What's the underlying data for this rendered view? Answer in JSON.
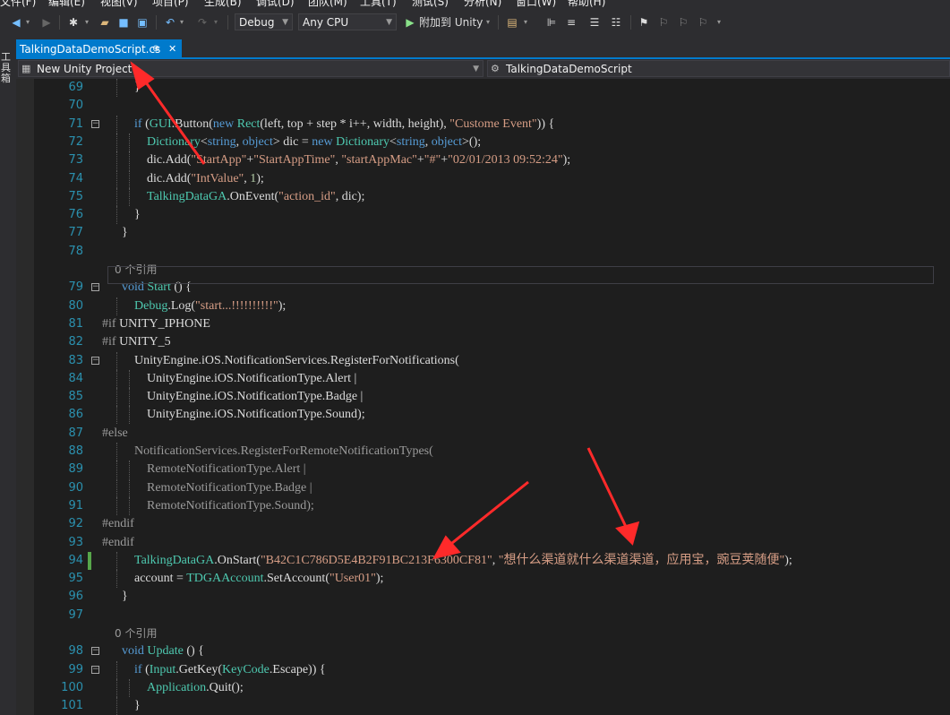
{
  "menu": [
    "文件(F)",
    "编辑(E)",
    "视图(V)",
    "项目(P)",
    "生成(B)",
    "调试(D)",
    "团队(M)",
    "工具(T)",
    "测试(S)",
    "分析(N)",
    "窗口(W)",
    "帮助(H)"
  ],
  "toolbar": {
    "config": "Debug",
    "platform": "Any CPU",
    "attach": "附加到 Unity",
    "play_glyph": "▶"
  },
  "left_strip": "工具箱",
  "tab": {
    "title": "TalkingDataDemoScript.cs",
    "pin": "⊕",
    "close": "✕"
  },
  "navbar": {
    "project": "New Unity Project",
    "class": "TalkingDataDemoScript"
  },
  "code_lines": [
    {
      "n": "69",
      "fold": "",
      "indent": 2,
      "segs": [
        {
          "t": "}",
          "c": ""
        }
      ]
    },
    {
      "n": "70",
      "fold": "",
      "indent": 0,
      "segs": []
    },
    {
      "n": "71",
      "fold": "−",
      "indent": 2,
      "segs": [
        {
          "t": "if",
          "c": "kw"
        },
        {
          "t": " (",
          "c": ""
        },
        {
          "t": "GUI",
          "c": "ty"
        },
        {
          "t": ".Button(",
          "c": ""
        },
        {
          "t": "new",
          "c": "kw"
        },
        {
          "t": " ",
          "c": ""
        },
        {
          "t": "Rect",
          "c": "ty"
        },
        {
          "t": "(left, top + step * i++, width, height), ",
          "c": ""
        },
        {
          "t": "\"Custome Event\"",
          "c": "st"
        },
        {
          "t": ")) {",
          "c": ""
        }
      ]
    },
    {
      "n": "72",
      "fold": "",
      "indent": 3,
      "segs": [
        {
          "t": "Dictionary",
          "c": "ty"
        },
        {
          "t": "<",
          "c": ""
        },
        {
          "t": "string",
          "c": "kw"
        },
        {
          "t": ", ",
          "c": ""
        },
        {
          "t": "object",
          "c": "kw"
        },
        {
          "t": "> dic = ",
          "c": ""
        },
        {
          "t": "new",
          "c": "kw"
        },
        {
          "t": " ",
          "c": ""
        },
        {
          "t": "Dictionary",
          "c": "ty"
        },
        {
          "t": "<",
          "c": ""
        },
        {
          "t": "string",
          "c": "kw"
        },
        {
          "t": ", ",
          "c": ""
        },
        {
          "t": "object",
          "c": "kw"
        },
        {
          "t": ">();",
          "c": ""
        }
      ]
    },
    {
      "n": "73",
      "fold": "",
      "indent": 3,
      "segs": [
        {
          "t": "dic.Add(",
          "c": ""
        },
        {
          "t": "\"StartApp\"",
          "c": "st"
        },
        {
          "t": "+",
          "c": ""
        },
        {
          "t": "\"StartAppTime\"",
          "c": "st"
        },
        {
          "t": ", ",
          "c": ""
        },
        {
          "t": "\"startAppMac\"",
          "c": "st"
        },
        {
          "t": "+",
          "c": ""
        },
        {
          "t": "\"#\"",
          "c": "st"
        },
        {
          "t": "+",
          "c": ""
        },
        {
          "t": "\"02/01/2013 09:52:24\"",
          "c": "st"
        },
        {
          "t": ");",
          "c": ""
        }
      ]
    },
    {
      "n": "74",
      "fold": "",
      "indent": 3,
      "segs": [
        {
          "t": "dic.Add(",
          "c": ""
        },
        {
          "t": "\"IntValue\"",
          "c": "st"
        },
        {
          "t": ", ",
          "c": ""
        },
        {
          "t": "1",
          "c": "nm"
        },
        {
          "t": ");",
          "c": ""
        }
      ]
    },
    {
      "n": "75",
      "fold": "",
      "indent": 3,
      "segs": [
        {
          "t": "TalkingDataGA",
          "c": "ty"
        },
        {
          "t": ".OnEvent(",
          "c": ""
        },
        {
          "t": "\"action_id\"",
          "c": "st"
        },
        {
          "t": ", dic);",
          "c": ""
        }
      ]
    },
    {
      "n": "76",
      "fold": "",
      "indent": 2,
      "segs": [
        {
          "t": "}",
          "c": ""
        }
      ]
    },
    {
      "n": "77",
      "fold": "",
      "indent": 1,
      "segs": [
        {
          "t": "}",
          "c": ""
        }
      ]
    },
    {
      "n": "78",
      "fold": "",
      "indent": 0,
      "segs": []
    },
    {
      "n": "",
      "fold": "",
      "indent": 1,
      "lens": "0 个引用",
      "segs": []
    },
    {
      "n": "79",
      "fold": "−",
      "indent": 1,
      "segs": [
        {
          "t": "void",
          "c": "kw"
        },
        {
          "t": " ",
          "c": ""
        },
        {
          "t": "Start",
          "c": "ty"
        },
        {
          "t": " () {",
          "c": ""
        }
      ]
    },
    {
      "n": "80",
      "fold": "",
      "indent": 2,
      "segs": [
        {
          "t": "Debug",
          "c": "ty"
        },
        {
          "t": ".Log(",
          "c": ""
        },
        {
          "t": "\"start...!!!!!!!!!!\"",
          "c": "st"
        },
        {
          "t": ");",
          "c": ""
        }
      ]
    },
    {
      "n": "81",
      "fold": "",
      "indent": 0,
      "segs": [
        {
          "t": "#if",
          "c": "pp"
        },
        {
          "t": " UNITY_IPHONE",
          "c": ""
        }
      ]
    },
    {
      "n": "82",
      "fold": "",
      "indent": 0,
      "segs": [
        {
          "t": "#if",
          "c": "pp"
        },
        {
          "t": " UNITY_5",
          "c": ""
        }
      ]
    },
    {
      "n": "83",
      "fold": "−",
      "indent": 2,
      "segs": [
        {
          "t": "UnityEngine.iOS.NotificationServices.RegisterForNotifications(",
          "c": ""
        }
      ]
    },
    {
      "n": "84",
      "fold": "",
      "indent": 3,
      "segs": [
        {
          "t": "UnityEngine.iOS.NotificationType.Alert |",
          "c": ""
        }
      ]
    },
    {
      "n": "85",
      "fold": "",
      "indent": 3,
      "segs": [
        {
          "t": "UnityEngine.iOS.NotificationType.Badge |",
          "c": ""
        }
      ]
    },
    {
      "n": "86",
      "fold": "",
      "indent": 3,
      "segs": [
        {
          "t": "UnityEngine.iOS.NotificationType.Sound);",
          "c": ""
        }
      ]
    },
    {
      "n": "87",
      "fold": "",
      "indent": 0,
      "segs": [
        {
          "t": "#else",
          "c": "pp"
        }
      ]
    },
    {
      "n": "88",
      "fold": "",
      "indent": 2,
      "segs": [
        {
          "t": "NotificationServices.RegisterForRemoteNotificationTypes(",
          "c": "pp"
        }
      ]
    },
    {
      "n": "89",
      "fold": "",
      "indent": 3,
      "segs": [
        {
          "t": "RemoteNotificationType.Alert |",
          "c": "pp"
        }
      ]
    },
    {
      "n": "90",
      "fold": "",
      "indent": 3,
      "segs": [
        {
          "t": "RemoteNotificationType.Badge |",
          "c": "pp"
        }
      ]
    },
    {
      "n": "91",
      "fold": "",
      "indent": 3,
      "segs": [
        {
          "t": "RemoteNotificationType.Sound);",
          "c": "pp"
        }
      ]
    },
    {
      "n": "92",
      "fold": "",
      "indent": 0,
      "segs": [
        {
          "t": "#endif",
          "c": "pp"
        }
      ]
    },
    {
      "n": "93",
      "fold": "",
      "indent": 0,
      "segs": [
        {
          "t": "#endif",
          "c": "pp"
        }
      ]
    },
    {
      "n": "94",
      "fold": "",
      "indent": 2,
      "segs": [
        {
          "t": "TalkingDataGA",
          "c": "ty"
        },
        {
          "t": ".OnStart(",
          "c": ""
        },
        {
          "t": "\"B42C1C786D5E4B2F91BC213F6300CF81\"",
          "c": "st"
        },
        {
          "t": ", ",
          "c": ""
        },
        {
          "t": "\"想什么渠道就什么渠道渠道，应用宝，豌豆荚随便\"",
          "c": "st"
        },
        {
          "t": ");",
          "c": ""
        }
      ]
    },
    {
      "n": "95",
      "fold": "",
      "indent": 2,
      "segs": [
        {
          "t": "account = ",
          "c": ""
        },
        {
          "t": "TDGAAccount",
          "c": "ty"
        },
        {
          "t": ".SetAccount(",
          "c": ""
        },
        {
          "t": "\"User01\"",
          "c": "st"
        },
        {
          "t": ");",
          "c": ""
        }
      ]
    },
    {
      "n": "96",
      "fold": "",
      "indent": 1,
      "segs": [
        {
          "t": "}",
          "c": ""
        }
      ]
    },
    {
      "n": "97",
      "fold": "",
      "indent": 0,
      "segs": []
    },
    {
      "n": "",
      "fold": "",
      "indent": 1,
      "lens": "0 个引用",
      "segs": []
    },
    {
      "n": "98",
      "fold": "−",
      "indent": 1,
      "segs": [
        {
          "t": "void",
          "c": "kw"
        },
        {
          "t": " ",
          "c": ""
        },
        {
          "t": "Update",
          "c": "ty"
        },
        {
          "t": " () {",
          "c": ""
        }
      ]
    },
    {
      "n": "99",
      "fold": "−",
      "indent": 2,
      "segs": [
        {
          "t": "if",
          "c": "kw"
        },
        {
          "t": " (",
          "c": ""
        },
        {
          "t": "Input",
          "c": "ty"
        },
        {
          "t": ".GetKey(",
          "c": ""
        },
        {
          "t": "KeyCode",
          "c": "ty"
        },
        {
          "t": ".Escape)) {",
          "c": ""
        }
      ]
    },
    {
      "n": "100",
      "fold": "",
      "indent": 3,
      "segs": [
        {
          "t": "Application",
          "c": "ty"
        },
        {
          "t": ".Quit();",
          "c": ""
        }
      ]
    },
    {
      "n": "101",
      "fold": "",
      "indent": 2,
      "segs": [
        {
          "t": "}",
          "c": ""
        }
      ]
    }
  ]
}
